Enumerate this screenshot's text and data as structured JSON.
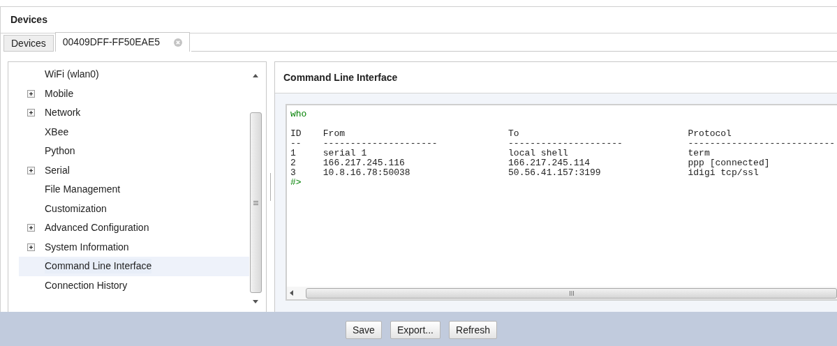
{
  "panel": {
    "title": "Devices"
  },
  "tabs": [
    {
      "label": "Devices",
      "selected": false,
      "closable": false
    },
    {
      "label": "00409DFF-FF50EAE5",
      "selected": true,
      "closable": true
    }
  ],
  "tree": {
    "items": [
      {
        "label": "WiFi (wlan0)",
        "expandable": false,
        "selected": false
      },
      {
        "label": "Mobile",
        "expandable": true,
        "selected": false
      },
      {
        "label": "Network",
        "expandable": true,
        "selected": false
      },
      {
        "label": "XBee",
        "expandable": false,
        "selected": false
      },
      {
        "label": "Python",
        "expandable": false,
        "selected": false
      },
      {
        "label": "Serial",
        "expandable": true,
        "selected": false
      },
      {
        "label": "File Management",
        "expandable": false,
        "selected": false
      },
      {
        "label": "Customization",
        "expandable": false,
        "selected": false
      },
      {
        "label": "Advanced Configuration",
        "expandable": true,
        "selected": false
      },
      {
        "label": "System Information",
        "expandable": true,
        "selected": false
      },
      {
        "label": "Command Line Interface",
        "expandable": false,
        "selected": true
      },
      {
        "label": "Connection History",
        "expandable": false,
        "selected": false
      }
    ]
  },
  "cli": {
    "title": "Command Line Interface",
    "lines": [
      {
        "kind": "command",
        "text": "who"
      },
      {
        "kind": "blank"
      },
      {
        "kind": "output",
        "text": "ID    From                              To                               Protocol"
      },
      {
        "kind": "output",
        "text": "--    ---------------------             ---------------------            ---------------------------"
      },
      {
        "kind": "output",
        "text": "1     serial 1                          local shell                      term"
      },
      {
        "kind": "output",
        "text": "2     166.217.245.116                   166.217.245.114                  ppp [connected]"
      },
      {
        "kind": "output",
        "text": "3     10.8.16.78:50038                  50.56.41.157:3199                idigi tcp/ssl"
      },
      {
        "kind": "prompt",
        "text": "#>"
      }
    ]
  },
  "buttons": [
    {
      "label": "Save"
    },
    {
      "label": "Export..."
    },
    {
      "label": "Refresh"
    }
  ]
}
